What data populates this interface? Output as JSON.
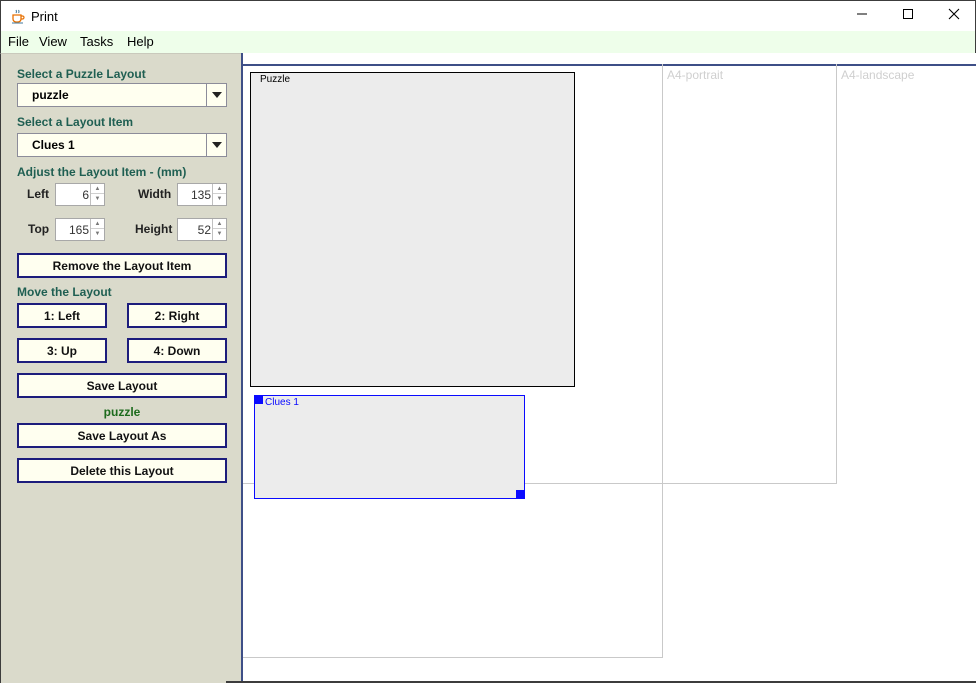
{
  "window": {
    "title": "Print",
    "icon": "java-coffee-icon"
  },
  "menu": [
    "File",
    "View",
    "Tasks",
    "Help"
  ],
  "panel": {
    "select_layout_label": "Select a Puzzle Layout",
    "layout_value": "puzzle",
    "select_item_label": "Select a Layout Item",
    "item_value": "Clues 1",
    "adjust_label": "Adjust the Layout Item - (mm)",
    "left_label": "Left",
    "left_value": "6",
    "width_label": "Width",
    "width_value": "135",
    "top_label": "Top",
    "top_value": "165",
    "height_label": "Height",
    "height_value": "52",
    "remove_button": "Remove the Layout Item",
    "move_label": "Move the Layout",
    "move_left": "1: Left",
    "move_right": "2: Right",
    "move_up": "3: Up",
    "move_down": "4: Down",
    "save_layout": "Save Layout",
    "current_layout": "puzzle",
    "save_layout_as": "Save Layout As",
    "delete_layout": "Delete this Layout"
  },
  "canvas": {
    "page_a4_portrait": "A4-portrait",
    "page_a4_landscape": "A4-landscape",
    "item_puzzle": "Puzzle",
    "item_clues": "Clues 1"
  },
  "colors": {
    "panel_bg": "#dadacb",
    "menubar_bg": "#eefeea",
    "label_green": "#1f5f52",
    "button_border": "#1c1c7c",
    "selected_item": "#0a0aff"
  }
}
